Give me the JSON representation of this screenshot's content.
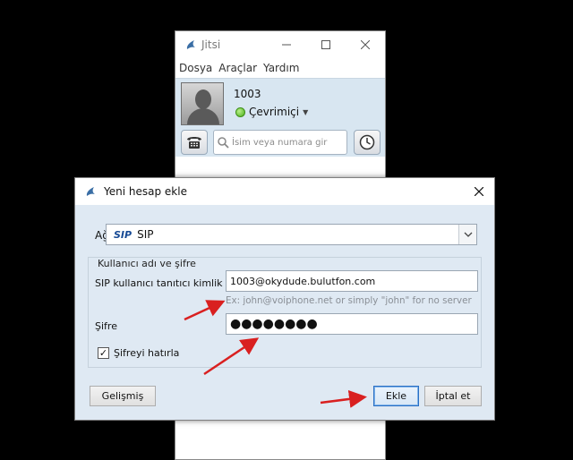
{
  "main_window": {
    "title": "Jitsi",
    "menu": [
      "Dosya",
      "Araçlar",
      "Yardım"
    ],
    "account_number": "1003",
    "status": "Çevrimiçi",
    "search_placeholder": "İsim veya numara gir"
  },
  "dialog": {
    "title": "Yeni hesap ekle",
    "network_label": "Ağ",
    "network_logo_text": "SIP",
    "network_value": "SIP",
    "group_title": "Kullanıcı adı ve şifre",
    "username_label": "SIP kullanıcı tanıtıcı kimlik",
    "username_value": "1003@okydude.bulutfon.com",
    "username_hint": "Ex: john@voiphone.net or simply \"john\" for no server",
    "password_label": "Şifre",
    "password_value": "●●●●●●●●",
    "remember_label": "Şifreyi hatırla",
    "remember_checked": true,
    "advanced_button": "Gelişmiş",
    "add_button": "Ekle",
    "cancel_button": "İptal et"
  },
  "colors": {
    "annotation_arrow": "#d92020",
    "panel_bg": "#dfe9f3",
    "status_green": "#4aae1a"
  }
}
